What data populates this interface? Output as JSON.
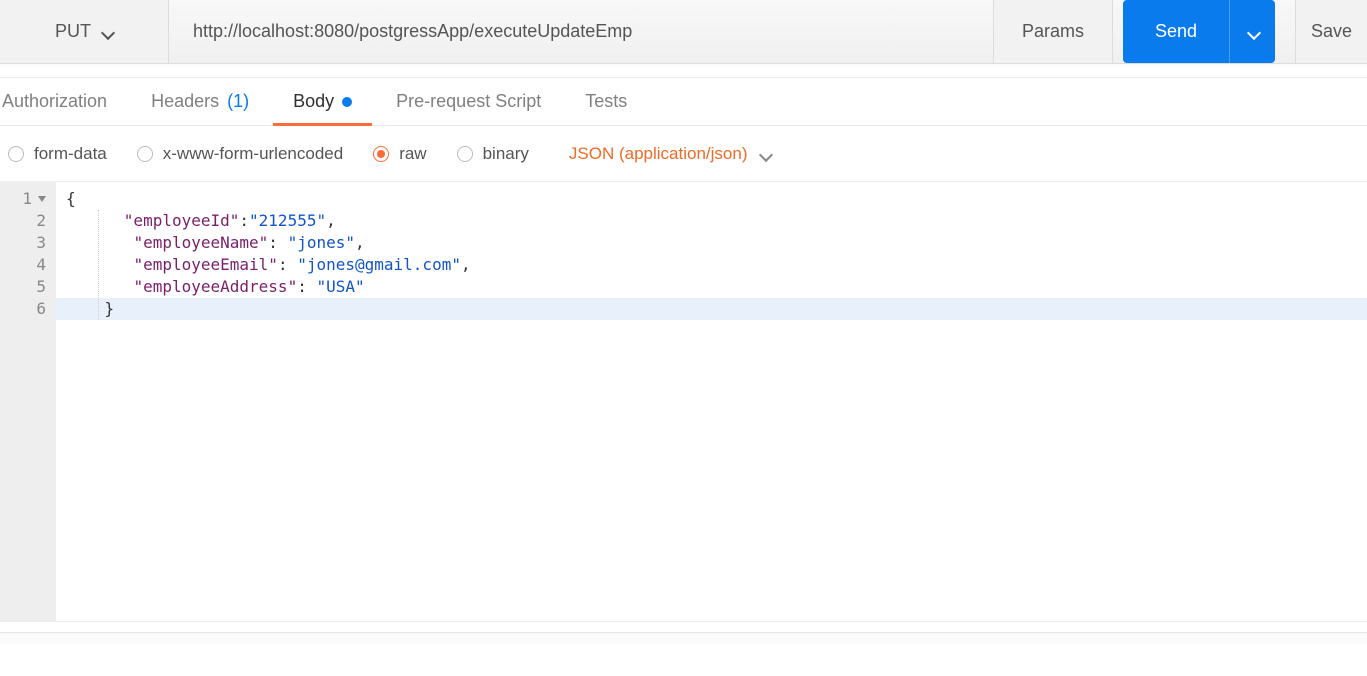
{
  "request": {
    "method": "PUT",
    "url": "http://localhost:8080/postgressApp/executeUpdateEmp"
  },
  "buttons": {
    "params": "Params",
    "send": "Send",
    "save": "Save"
  },
  "tabs": {
    "authorization": "Authorization",
    "headers_label": "Headers",
    "headers_count": "(1)",
    "body": "Body",
    "prerequest": "Pre-request Script",
    "tests": "Tests"
  },
  "body_types": {
    "form_data": "form-data",
    "x_www": "x-www-form-urlencoded",
    "raw": "raw",
    "binary": "binary",
    "content_type": "JSON (application/json)"
  },
  "editor": {
    "lines": [
      "1",
      "2",
      "3",
      "4",
      "5",
      "6"
    ],
    "json": {
      "k1": "\"employeeId\"",
      "v1": "\"212555\"",
      "k2": "\"employeeName\"",
      "v2": "\"jones\"",
      "k3": "\"employeeEmail\"",
      "v3": "\"jones@gmail.com\"",
      "k4": "\"employeeAddress\"",
      "v4": "\"USA\""
    }
  }
}
